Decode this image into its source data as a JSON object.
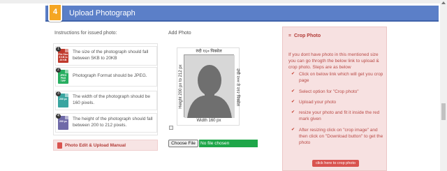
{
  "section": {
    "step_number": "4",
    "title": "Upload Photograph"
  },
  "instructions": {
    "heading": "Instructions for issued photo:",
    "items": [
      {
        "icon": "file-size-icon",
        "icon_caption": "File Size 5 KB to 20 KB",
        "text": "The size of the photograph should fall between 5KB to 20KB",
        "color": "#c0392b"
      },
      {
        "icon": "file-format-icon",
        "icon_caption": "JPEG PNG TIFF",
        "text": "Photograph Format should be JPEG.",
        "color": "#27ae60"
      },
      {
        "icon": "width-icon",
        "icon_caption": "200 px",
        "text": "The width of the photograph should be 160 pixels.",
        "color": "#3aa5a0"
      },
      {
        "icon": "height-icon",
        "icon_caption": "200 px",
        "text": "The height of the photograph should fall between 200 to 212 pixels.",
        "color": "#6f6aa8"
      }
    ],
    "manual_link": "Photo Edit & Upload Manual"
  },
  "add_photo": {
    "heading": "Add Photo",
    "dim_top": "रुंदी १६० पिक्सेल",
    "dim_bottom": "Width 160 px",
    "dim_left": "Height 200 px to 212 px",
    "dim_right": "उंची २०० ते २१२ पिक्सेल",
    "choose_file_label": "Choose File",
    "no_file_text": "No file chosen"
  },
  "crop": {
    "title": "Crop Photo",
    "intro": "If you dont have photo in this mentioned size you can go throgth the below link to upload & crop photo. Steps are as below",
    "steps": [
      "Click on below link which will get you crop page",
      "Select option for \"Crop photo\"",
      "Upload your photo",
      "resize your photo and fit it inside the red mark given",
      "After resizing click on \"crop image\" and then click on \"Download button\" to get the photo"
    ],
    "button_label": "click here to crop photo"
  },
  "colors": {
    "header_blue": "#5b7fc8",
    "badge_orange": "#f5a623",
    "crop_panel_bg": "#f7e1e1",
    "crop_text": "#b84a46",
    "file_input_green": "#1ea649"
  }
}
